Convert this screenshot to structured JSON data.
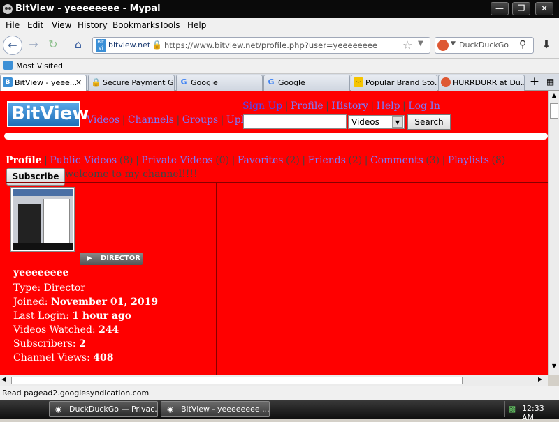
{
  "window": {
    "title": "BitView - yeeeeeeee - Mypal"
  },
  "menu": [
    "File",
    "Edit",
    "View",
    "History",
    "Bookmarks",
    "Tools",
    "Help"
  ],
  "nav": {
    "site_badge": "bitview.net",
    "url": "https://www.bitview.net/profile.php?user=yeeeeeeee",
    "search_engine": "DuckDuckGo"
  },
  "bookmarks": {
    "most_visited": "Most Visited"
  },
  "tabs": [
    {
      "label": "BitView - yeee...",
      "active": true,
      "icon": "bitview-icon"
    },
    {
      "label": "Secure Payment G...",
      "icon": "lock-icon"
    },
    {
      "label": "Google",
      "icon": "google-icon"
    },
    {
      "label": "Google",
      "icon": "google-icon"
    },
    {
      "label": "Popular Brand Sto...",
      "icon": "smile-icon"
    },
    {
      "label": "HURRDURR at Du...",
      "icon": "duckduckgo-icon"
    }
  ],
  "site": {
    "logo_text": "BitView",
    "top_links": [
      "Sign Up",
      "Profile",
      "History",
      "Help",
      "Log In"
    ],
    "main_links": [
      "Videos",
      "Channels",
      "Groups",
      "Upload"
    ],
    "search_select": "Videos",
    "search_button": "Search",
    "profile_tabs": [
      {
        "label": "Profile",
        "count": ""
      },
      {
        "label": "Public Videos",
        "count": "(8)"
      },
      {
        "label": "Private Videos",
        "count": "(0)"
      },
      {
        "label": "Favorites",
        "count": "(2)"
      },
      {
        "label": "Friends",
        "count": "(2)"
      },
      {
        "label": "Comments",
        "count": "(3)"
      },
      {
        "label": "Playlists",
        "count": "(8)"
      }
    ],
    "subscribe": "Subscribe",
    "channel_message": "welcome to my channel!!!!",
    "director_badge": "DIRECTOR",
    "username": "yeeeeeeee",
    "stats": [
      {
        "label": "Type:",
        "value": "Director",
        "bold": false
      },
      {
        "label": "Joined:",
        "value": "November 01, 2019",
        "bold": true
      },
      {
        "label": "Last Login:",
        "value": "1 hour ago",
        "bold": true
      },
      {
        "label": "Videos Watched:",
        "value": "244",
        "bold": true
      },
      {
        "label": "Subscribers:",
        "value": "2",
        "bold": true
      },
      {
        "label": "Channel Views:",
        "value": "408",
        "bold": true
      }
    ]
  },
  "status": "Read pagead2.googlesyndication.com",
  "taskbar": {
    "items": [
      "DuckDuckGo — Privac...",
      "BitView - yeeeeeeee ..."
    ],
    "clock": "12:33 AM"
  },
  "colors": {
    "page_bg": "#ff0000",
    "link": "#7a7aff",
    "logo_blue": "#3b8fd6"
  }
}
